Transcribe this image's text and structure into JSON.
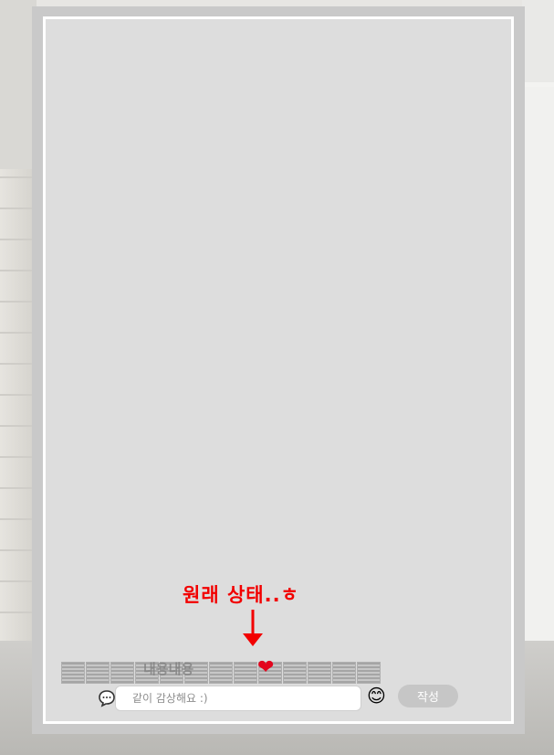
{
  "annotation": {
    "text": "원래 상태..ㅎ",
    "color": "#f20000"
  },
  "memo": {
    "handwritten_text": "내용내용"
  },
  "comment": {
    "placeholder": "같이 감상해요 :)",
    "submit_label": "작성"
  },
  "icons": {
    "chat": "chat-bubble-icon",
    "emoji": "smiley-emoji-icon",
    "heart": "heart-icon",
    "arrow": "down-arrow-icon"
  },
  "colors": {
    "panel": "#dddddd",
    "frame": "#c9c9c9",
    "button": "#c6c6c6",
    "heart": "#e3051d"
  }
}
